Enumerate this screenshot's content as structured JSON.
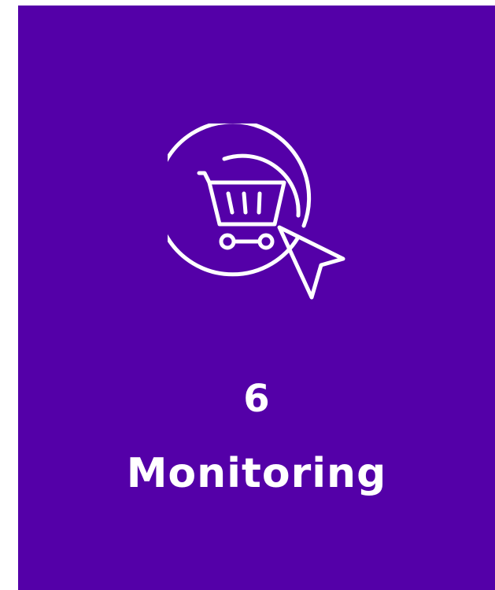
{
  "card": {
    "step_number": "6",
    "title": "Monitoring",
    "background_color": "#5400a8",
    "text_color": "#ffffff"
  },
  "icon": {
    "name": "shopping-cart-click-icon"
  }
}
